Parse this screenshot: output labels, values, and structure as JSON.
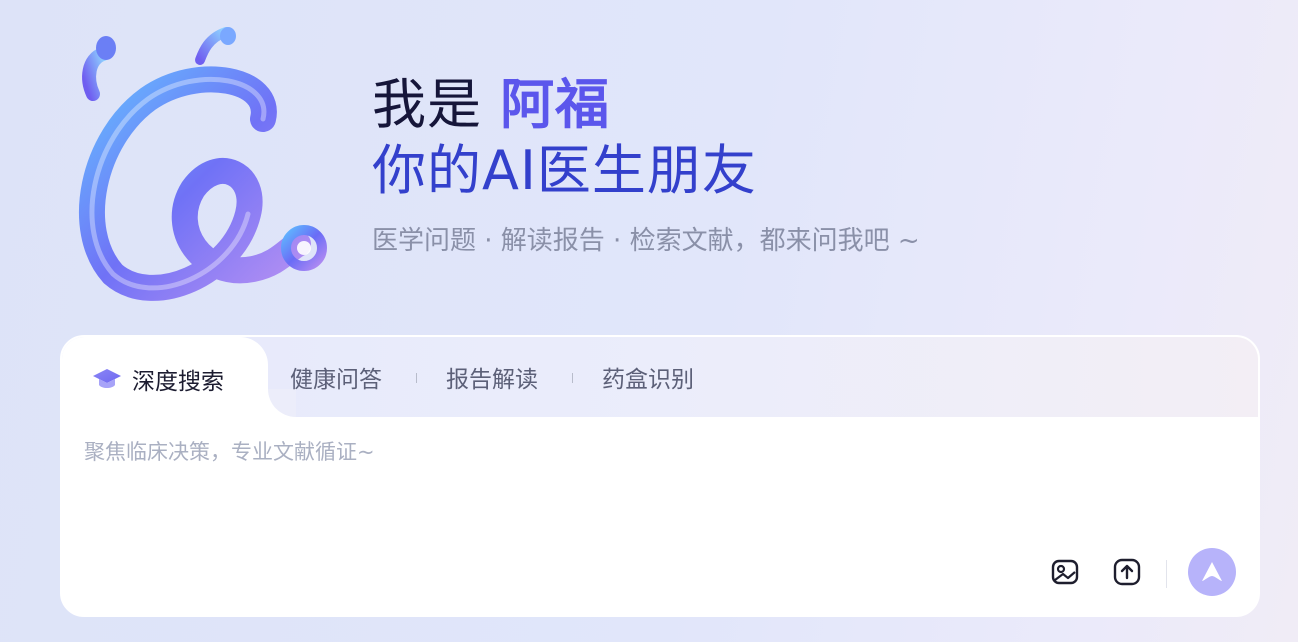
{
  "hero": {
    "intro": "我是",
    "name": "阿福",
    "tagline": "你的AI医生朋友",
    "subtitle": "医学问题 · 解读报告 · 检索文献，都来问我吧 ~"
  },
  "tabs": [
    {
      "label": "深度搜索",
      "active": true,
      "icon": "graduation-cap-icon"
    },
    {
      "label": "健康问答",
      "active": false
    },
    {
      "label": "报告解读",
      "active": false
    },
    {
      "label": "药盒识别",
      "active": false
    }
  ],
  "input": {
    "placeholder": "聚焦临床决策，专业文献循证~",
    "value": ""
  },
  "toolbar": {
    "image_icon": "image-icon",
    "upload_icon": "upload-icon",
    "send_icon": "send-arrow-icon"
  },
  "colors": {
    "accent": "#5b56ec",
    "send": "#b7b3fa"
  }
}
